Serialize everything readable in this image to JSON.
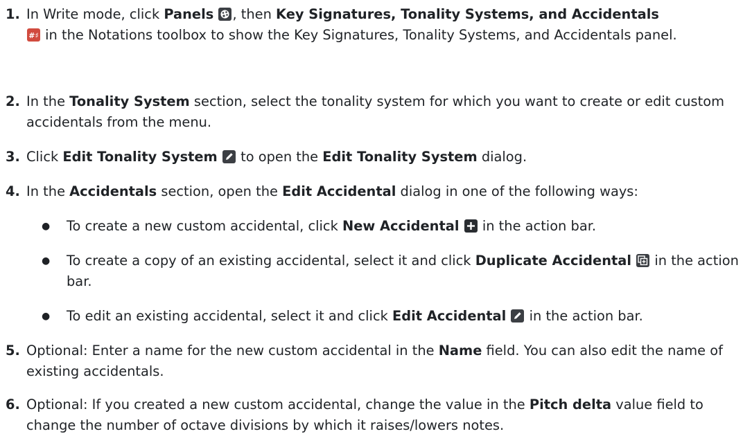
{
  "steps": [
    {
      "num": "1.",
      "t1": "In Write mode, click ",
      "b1": "Panels",
      "t2": ", then ",
      "b2": "Key Signatures, Tonality Systems, and Accidentals",
      "t3": " in the Notations toolbox to show the Key Signatures, Tonality Systems, and Accidentals panel."
    },
    {
      "num": "2.",
      "t1": "In the ",
      "b1": "Tonality System",
      "t2": " section, select the tonality system for which you want to create or edit custom accidentals from the menu."
    },
    {
      "num": "3.",
      "t1": "Click ",
      "b1": "Edit Tonality System",
      "t2": " to open the ",
      "b2": "Edit Tonality System",
      "t3": " dialog."
    },
    {
      "num": "4.",
      "t1": "In the ",
      "b1": "Accidentals",
      "t2": " section, open the ",
      "b2": "Edit Accidental",
      "t3": " dialog in one of the following ways:"
    },
    {
      "num": "5.",
      "t1": "Optional: Enter a name for the new custom accidental in the ",
      "b1": "Name",
      "t2": " field. You can also edit the name of existing accidentals."
    },
    {
      "num": "6.",
      "t1": "Optional: If you created a new custom accidental, change the value in the ",
      "b1": "Pitch delta",
      "t2": " value field to change the number of octave divisions by which it raises/lowers notes."
    }
  ],
  "bullets": [
    {
      "t1": "To create a new custom accidental, click ",
      "b1": "New Accidental",
      "t2": " in the action bar."
    },
    {
      "t1": "To create a copy of an existing accidental, select it and click ",
      "b1": "Duplicate Accidental",
      "t2": " in the action bar."
    },
    {
      "t1": "To edit an existing accidental, select it and click ",
      "b1": "Edit Accidental",
      "t2": " in the action bar."
    }
  ],
  "bullet_glyph": "●",
  "icons": {
    "panels": "palette-icon",
    "key_signatures": "sharp-icon",
    "edit": "pencil-icon",
    "new": "plus-icon",
    "duplicate": "duplicate-icon"
  }
}
